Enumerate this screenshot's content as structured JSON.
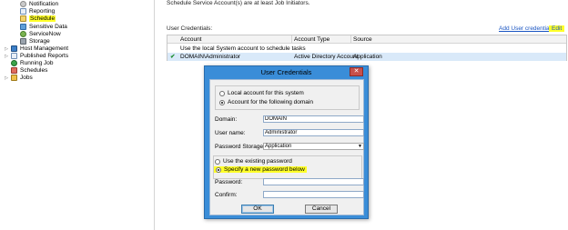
{
  "tree": {
    "items": [
      {
        "label": "Notification",
        "icon": "gear-icon"
      },
      {
        "label": "Reporting",
        "icon": "report-icon"
      },
      {
        "label": "Schedule",
        "icon": "schedule-icon"
      },
      {
        "label": "Sensitive Data",
        "icon": "database-icon"
      },
      {
        "label": "ServiceNow",
        "icon": "servicenow-icon"
      },
      {
        "label": "Storage",
        "icon": "storage-icon"
      },
      {
        "label": "Host Management",
        "icon": "host-icon"
      },
      {
        "label": "Published Reports",
        "icon": "published-reports-icon"
      },
      {
        "label": "Running Job",
        "icon": "running-job-icon"
      },
      {
        "label": "Schedules",
        "icon": "calendar-icon"
      },
      {
        "label": "Jobs",
        "icon": "jobs-icon"
      }
    ]
  },
  "main": {
    "note": "Schedule Service Account(s) are at least Job Initiators.",
    "credentials_label": "User Credentials:",
    "add_link": "Add User credential",
    "edit_link": "Edit",
    "grid": {
      "columns": [
        "Account",
        "Account Type",
        "Source"
      ],
      "rows": [
        {
          "account": "Use the local System account to schedule tasks",
          "type": "",
          "source": ""
        },
        {
          "account": "DOMAIN\\Administrator",
          "type": "Active Directory Account",
          "source": "Application",
          "checked": true
        }
      ]
    }
  },
  "dialog": {
    "title": "User Credentials",
    "close": "✕",
    "radio_local": "Local account for this system",
    "radio_domain": "Account for the following domain",
    "domain_label": "Domain:",
    "domain_value": "DOMAIN",
    "username_label": "User name:",
    "username_value": "Administrator",
    "storage_label": "Password Storage:",
    "storage_value": "Application",
    "radio_existing": "Use the existing password",
    "radio_new": "Specify a new password below",
    "password_label": "Password:",
    "confirm_label": "Confirm:",
    "ok": "OK",
    "cancel": "Cancel"
  },
  "colors": {
    "highlight": "#ffff2a",
    "dialog_frame": "#3a8dd8",
    "link": "#1a55c2",
    "selected_row": "#d9e9f9"
  }
}
